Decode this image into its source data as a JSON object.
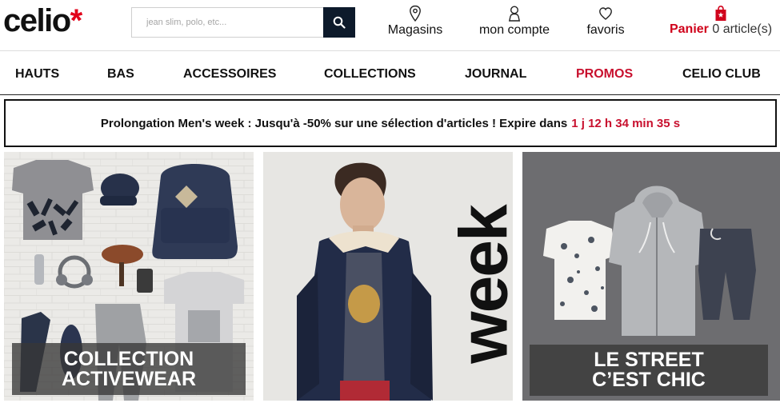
{
  "header": {
    "logo_text": "celio",
    "logo_star": "*",
    "search_placeholder": "jean slim, polo, etc...",
    "links": [
      {
        "label": "Magasins",
        "icon": "map-pin-icon"
      },
      {
        "label": "mon compte",
        "icon": "user-icon"
      },
      {
        "label": "favoris",
        "icon": "heart-icon"
      }
    ],
    "cart": {
      "label": "Panier",
      "count": "0 article(s)",
      "icon": "shopping-bag-icon"
    }
  },
  "nav": {
    "items": [
      "HAUTS",
      "BAS",
      "ACCESSOIRES",
      "COLLECTIONS",
      "JOURNAL",
      "PROMOS",
      "CELIO CLUB"
    ]
  },
  "banner": {
    "text": "Prolongation Men's week : Jusqu'à -50% sur une sélection d'articles ! Expire dans",
    "timer": "1 j 12 h 34 min 35 s"
  },
  "tiles": [
    {
      "caption_line1": "COLLECTION",
      "caption_line2": "ACTIVEWEAR"
    },
    {
      "overlay_text": "week"
    },
    {
      "caption_line1": "LE STREET",
      "caption_line2": "C’EST CHIC"
    }
  ],
  "colors": {
    "brand_red": "#e2001a",
    "promo_red": "#c8102e",
    "search_button": "#0d1a2b"
  }
}
